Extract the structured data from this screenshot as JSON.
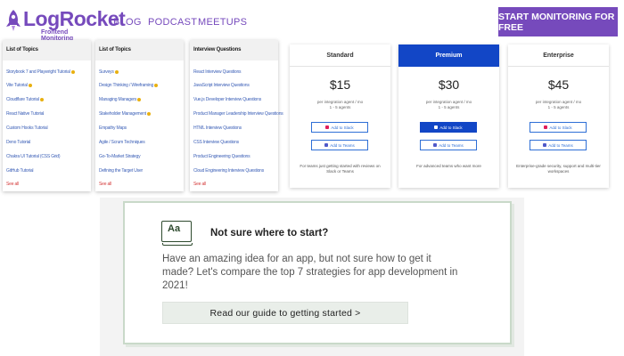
{
  "brand": {
    "name": "LogRocket",
    "tagline": "Frontend Monitoring",
    "color": "#764abc"
  },
  "nav": {
    "links": [
      "BLOG",
      "PODCAST",
      "MEETUPS"
    ],
    "cta": "START MONITORING FOR FREE"
  },
  "menus": [
    {
      "title": "List of Topics",
      "items": [
        {
          "label": "Storybook 7 and Playwright Tutorial",
          "badge": true
        },
        {
          "label": "Vite Tutorial",
          "badge": true
        },
        {
          "label": "Cloudflare Tutorial",
          "badge": true
        },
        {
          "label": "React Native Tutorial",
          "badge": false
        },
        {
          "label": "Custom Hooks Tutorial",
          "badge": false
        },
        {
          "label": "Deno Tutorial",
          "badge": false
        },
        {
          "label": "Chakra UI Tutorial (CSS Grid)",
          "badge": false
        },
        {
          "label": "GitHub Tutorial",
          "badge": false
        }
      ],
      "see_all": "See all"
    },
    {
      "title": "List of Topics",
      "items": [
        {
          "label": "Surveys",
          "badge": true
        },
        {
          "label": "Design Thinking / Wireframing",
          "badge": true
        },
        {
          "label": "Managing Managers",
          "badge": true
        },
        {
          "label": "Stakeholder Management",
          "badge": true
        },
        {
          "label": "Empathy Maps",
          "badge": false
        },
        {
          "label": "Agile / Scrum Techniques",
          "badge": false
        },
        {
          "label": "Go-To-Market Strategy",
          "badge": false
        },
        {
          "label": "Defining the Target User",
          "badge": false
        }
      ],
      "see_all": "See all"
    },
    {
      "title": "Interview Questions",
      "items": [
        {
          "label": "React Interview Questions",
          "badge": false
        },
        {
          "label": "JavaScript Interview Questions",
          "badge": false
        },
        {
          "label": "Vue.js Developer Interview Questions",
          "badge": false
        },
        {
          "label": "Product Manager Leadership Interview Questions",
          "badge": false
        },
        {
          "label": "HTML Interview Questions",
          "badge": false
        },
        {
          "label": "CSS Interview Questions",
          "badge": false
        },
        {
          "label": "Product Engineering Questions",
          "badge": false
        },
        {
          "label": "Cloud Engineering Interview Questions",
          "badge": false
        }
      ],
      "see_all": "See all"
    }
  ],
  "plans": [
    {
      "name": "Standard",
      "price": "$15",
      "desc1": "per integration agent / mo",
      "desc2": "1 - 5 agents",
      "slack": "Add to Slack",
      "teams": "Add to Teams",
      "note": "For teams just getting started with reviews on Slack or Teams",
      "featured": false
    },
    {
      "name": "Premium",
      "price": "$30",
      "desc1": "per integration agent / mo",
      "desc2": "1 - 5 agents",
      "slack": "Add to Slack",
      "teams": "Add to Teams",
      "note": "For advanced teams who want more",
      "featured": true
    },
    {
      "name": "Enterprise",
      "price": "$45",
      "desc1": "per integration agent / mo",
      "desc2": "1 - 5 agents",
      "slack": "Add to Slack",
      "teams": "Add to Teams",
      "note": "Enterprise-grade security, support and multi-tier workspaces",
      "featured": false
    }
  ],
  "guide": {
    "icon_text": "Aa",
    "title": "Not sure where to start?",
    "body": "Have an amazing idea for an app, but not sure how to get it made? Let's compare the top 7 strategies for app development in 2021!",
    "button": "Read our guide to getting started >"
  }
}
